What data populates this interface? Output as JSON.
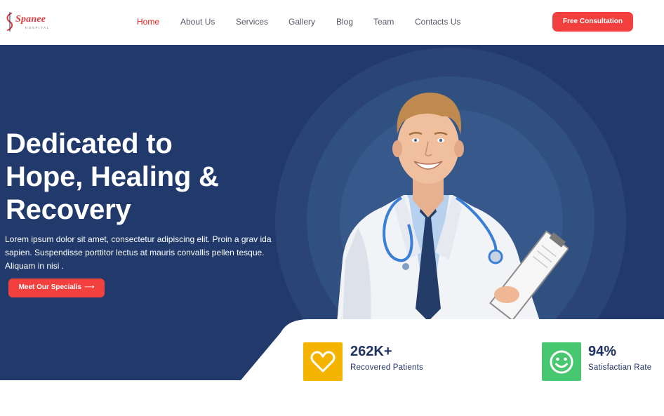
{
  "brand": {
    "name": "Spanee",
    "tagline": "hospital",
    "accent_color": "#f2403f",
    "navy_color": "#213a6b"
  },
  "nav": {
    "items": [
      {
        "label": "Home",
        "active": true
      },
      {
        "label": "About Us",
        "active": false
      },
      {
        "label": "Services",
        "active": false
      },
      {
        "label": "Gallery",
        "active": false
      },
      {
        "label": "Blog",
        "active": false
      },
      {
        "label": "Team",
        "active": false
      },
      {
        "label": "Contacts Us",
        "active": false
      }
    ],
    "cta_label": "Free Consultation"
  },
  "hero": {
    "title_lines": [
      "Dedicated to",
      "Hope, Healing &",
      "Recovery"
    ],
    "description": "Lorem ipsum dolor sit amet, consectetur adipiscing elit. Proin a grav ida sapien. Suspendisse porttitor lectus at mauris convallis pellen tesque. Aliquam in nisi .",
    "button_label": "Meet Our Specialis",
    "button_icon": "arrow-right-icon",
    "image": "smiling-doctor-with-stethoscope-and-clipboard"
  },
  "stats": [
    {
      "value": "262K+",
      "label": "Recovered Patients",
      "icon": "heart-icon",
      "color": "#f5b400"
    },
    {
      "value": "94%",
      "label": "Satisfactian Rate",
      "icon": "smile-icon",
      "color": "#47c770"
    }
  ]
}
